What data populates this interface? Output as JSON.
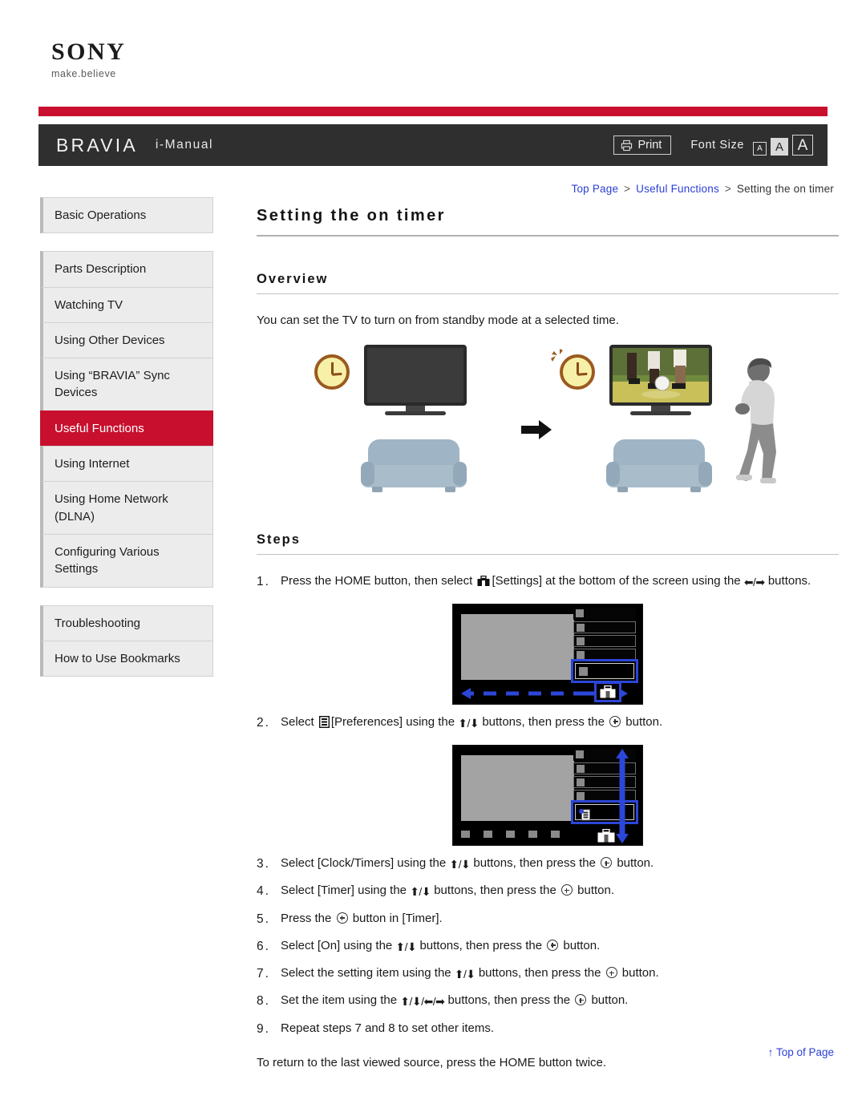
{
  "brand": {
    "logo_text": "SONY",
    "tagline": "make.believe"
  },
  "header": {
    "product": "BRAVIA",
    "manual": "i-Manual",
    "print_label": "Print",
    "print_icon": "printer-icon",
    "font_size_label": "Font Size",
    "font_size_options": [
      "A",
      "A",
      "A"
    ],
    "font_size_selected_index": 1,
    "accent_red": "#c8102e",
    "bar_dark": "#2f2f2f"
  },
  "breadcrumb": {
    "items": [
      "Top Page",
      "Useful Functions",
      "Setting the on timer"
    ],
    "separator": ">",
    "link_color": "#2b3fd4"
  },
  "sidebar": {
    "groups": [
      {
        "items": [
          {
            "label": "Basic Operations",
            "active": false
          }
        ]
      },
      {
        "items": [
          {
            "label": "Parts Description",
            "active": false
          },
          {
            "label": "Watching TV",
            "active": false
          },
          {
            "label": "Using Other Devices",
            "active": false
          },
          {
            "label": "Using “BRAVIA” Sync Devices",
            "active": false
          },
          {
            "label": "Useful Functions",
            "active": true
          },
          {
            "label": "Using Internet",
            "active": false
          },
          {
            "label": "Using Home Network (DLNA)",
            "active": false
          },
          {
            "label": "Configuring Various Settings",
            "active": false
          }
        ]
      },
      {
        "items": [
          {
            "label": "Troubleshooting",
            "active": false
          },
          {
            "label": "How to Use Bookmarks",
            "active": false
          }
        ]
      }
    ]
  },
  "main": {
    "page_title": "Setting the on timer",
    "overview_heading": "Overview",
    "overview_text": "You can set the TV to turn on from standby mode at a selected time.",
    "steps_heading": "Steps",
    "illustration": {
      "left_scene": "tv-off-with-clock-and-sofa",
      "transition_icon": "right-arrow-icon",
      "right_scene": "tv-on-showing-soccer-with-alarm-clock-sofa-and-person"
    },
    "steps": [
      {
        "num": "1.",
        "text_parts": [
          "Press the HOME button, then select ",
          "[Settings] at the bottom of the screen using the ",
          " buttons."
        ],
        "icons": [
          "toolbox-icon",
          "left-right-arrows-icon"
        ]
      },
      {
        "num": "2.",
        "text_parts": [
          "Select ",
          "[Preferences] using the ",
          " buttons, then press the ",
          " button."
        ],
        "icons": [
          "preferences-icon",
          "up-down-arrows-icon",
          "enter-icon"
        ]
      },
      {
        "num": "3.",
        "text_parts": [
          "Select [Clock/Timers] using the ",
          " buttons, then press the ",
          " button."
        ],
        "icons": [
          "up-down-arrows-icon",
          "enter-icon"
        ]
      },
      {
        "num": "4.",
        "text_parts": [
          "Select [Timer] using the ",
          " buttons, then press the ",
          " button."
        ],
        "icons": [
          "up-down-arrows-icon",
          "enter-icon"
        ]
      },
      {
        "num": "5.",
        "text_parts": [
          "Press the ",
          " button in [Timer]."
        ],
        "icons": [
          "enter-icon"
        ]
      },
      {
        "num": "6.",
        "text_parts": [
          "Select [On] using the ",
          " buttons, then press the ",
          " button."
        ],
        "icons": [
          "up-down-arrows-icon",
          "enter-icon"
        ]
      },
      {
        "num": "7.",
        "text_parts": [
          "Select the setting item using the ",
          " buttons, then press the ",
          " button."
        ],
        "icons": [
          "up-down-arrows-icon",
          "enter-icon"
        ]
      },
      {
        "num": "8.",
        "text_parts": [
          "Set the item using the ",
          " buttons, then press the ",
          " button."
        ],
        "icons": [
          "four-way-arrows-icon",
          "enter-icon"
        ]
      },
      {
        "num": "9.",
        "text_parts": [
          "Repeat steps 7 and 8 to set other items."
        ],
        "icons": []
      }
    ],
    "closing_text": "To return to the last viewed source, press the HOME button twice.",
    "mockup_1": {
      "caption": "home-menu-settings-row-highlighted",
      "highlight_color": "#2c46d8"
    },
    "mockup_2": {
      "caption": "settings-preferences-item-highlighted",
      "highlight_color": "#2c46d8"
    }
  },
  "footer": {
    "top_of_page": "Top of Page",
    "top_of_page_icon": "up-arrow-icon"
  }
}
